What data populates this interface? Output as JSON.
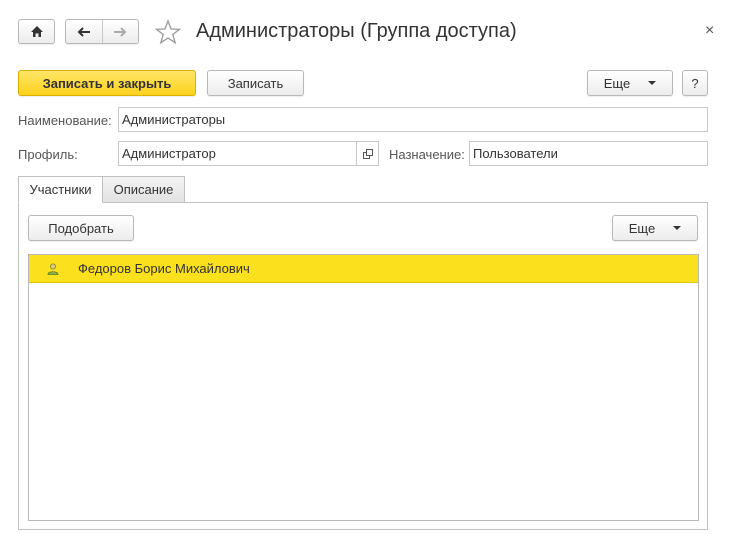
{
  "header": {
    "title": "Администраторы (Группа доступа)",
    "close_glyph": "×",
    "icons": [
      "home-icon",
      "arrow-left-icon",
      "arrow-right-icon",
      "star-icon"
    ]
  },
  "toolbar": {
    "save_close_label": "Записать и закрыть",
    "save_label": "Записать",
    "more_label": "Еще",
    "help_label": "?"
  },
  "form": {
    "name_label": "Наименование:",
    "name_value": "Администраторы",
    "profile_label": "Профиль:",
    "profile_value": "Администратор",
    "purpose_label": "Назначение:",
    "purpose_value": "Пользователи"
  },
  "tabs": [
    {
      "label": "Участники",
      "active": true
    },
    {
      "label": "Описание",
      "active": false
    }
  ],
  "members": {
    "pick_label": "Подобрать",
    "more_label": "Еще",
    "rows": [
      {
        "name": "Федоров Борис Михайлович",
        "icon": "user-icon",
        "selected": true
      }
    ]
  },
  "colors": {
    "accent_yellow": "#fcd21e",
    "selected_row": "#fbe01d",
    "border": "#c0c0c0"
  }
}
